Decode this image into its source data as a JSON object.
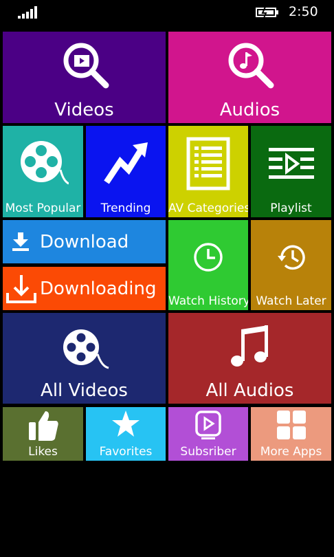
{
  "status_bar": {
    "time": "2:50"
  },
  "tiles": {
    "videos": {
      "label": "Videos",
      "color": "#4b0085"
    },
    "audios": {
      "label": "Audios",
      "color": "#d1158d"
    },
    "most_popular": {
      "label": "Most Popular",
      "color": "#1fb2a6"
    },
    "trending": {
      "label": "Trending",
      "color": "#0a14f0"
    },
    "av_categories": {
      "label": "AV Categories",
      "color": "#cdd100"
    },
    "playlist": {
      "label": "Playlist",
      "color": "#0a6a10"
    },
    "download": {
      "label": "Download",
      "color": "#1e86df"
    },
    "downloading": {
      "label": "Downloading",
      "color": "#fb4a05"
    },
    "watch_history": {
      "label": "Watch History",
      "color": "#2fca32"
    },
    "watch_later": {
      "label": "Watch Later",
      "color": "#b8820a"
    },
    "all_videos": {
      "label": "All Videos",
      "color": "#1d2870"
    },
    "all_audios": {
      "label": "All Audios",
      "color": "#a5272a"
    },
    "likes": {
      "label": "Likes",
      "color": "#5a7030"
    },
    "favorites": {
      "label": "Favorites",
      "color": "#27c3f3"
    },
    "subscriber": {
      "label": "Subsriber",
      "color": "#b24fd6"
    },
    "more_apps": {
      "label": "More Apps",
      "color": "#ec9a7e"
    }
  }
}
